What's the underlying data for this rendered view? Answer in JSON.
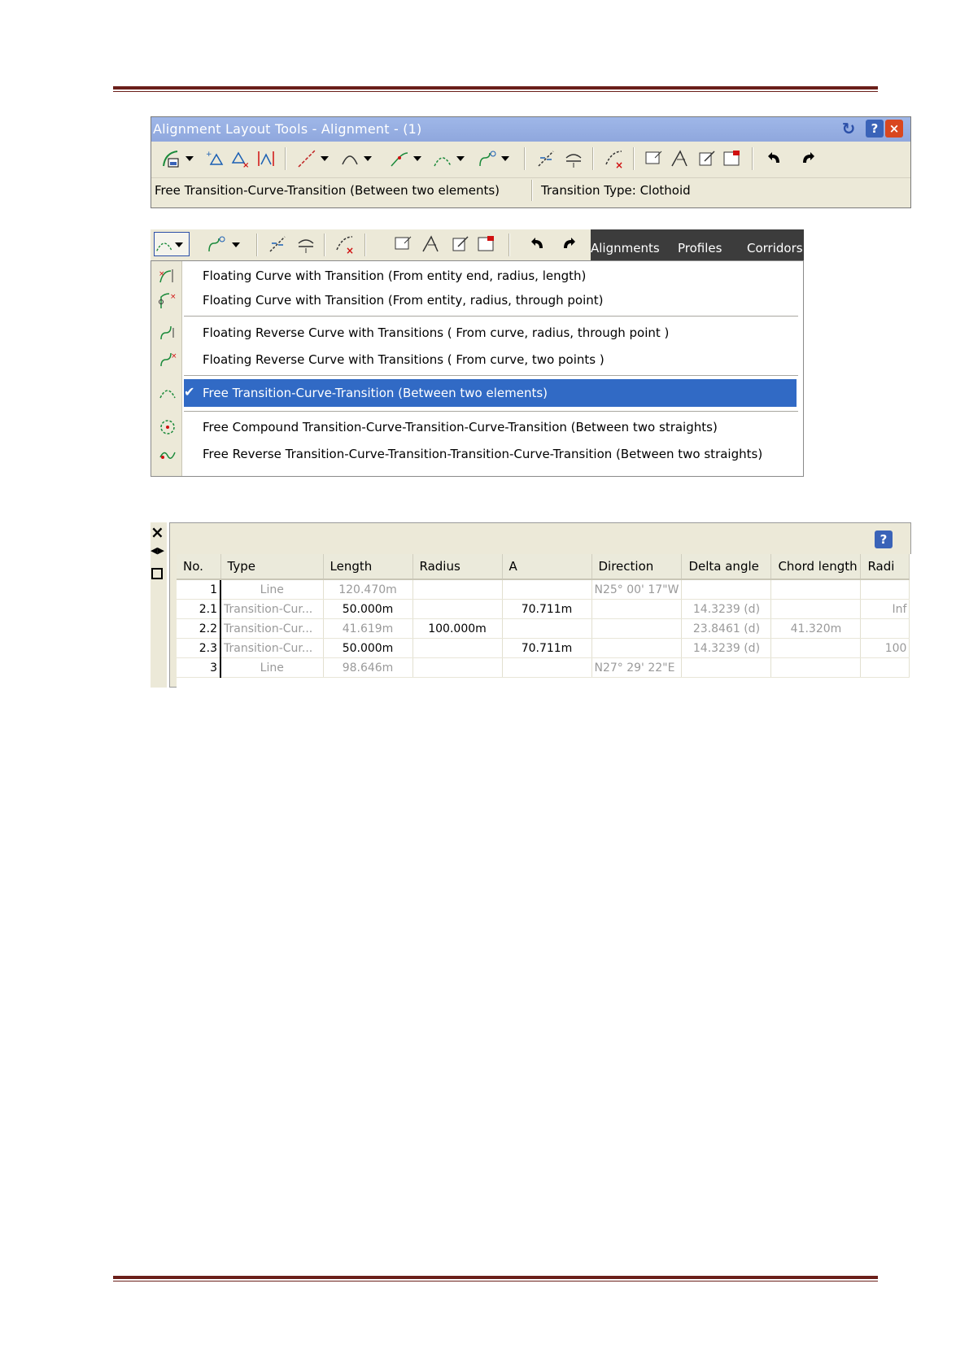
{
  "toolbar_window": {
    "title": "Alignment Layout Tools - Alignment - (1)",
    "status_left": "Free Transition-Curve-Transition (Between two elements)",
    "status_right": "Transition Type: Clothoid",
    "help_label": "?",
    "close_label": "×"
  },
  "menu_toolbar": {
    "tabs": [
      "Alignments",
      "Profiles",
      "Corridors"
    ]
  },
  "menu": {
    "items": [
      {
        "label": "Floating Curve with Transition (From entity end, radius, length)"
      },
      {
        "label": "Floating Curve with Transition (From entity, radius, through point)"
      },
      {
        "label": "Floating Reverse Curve with Transitions ( From curve, radius, through point )"
      },
      {
        "label": "Floating Reverse Curve with Transitions ( From curve, two points )"
      },
      {
        "label": "Free Transition-Curve-Transition (Between two elements)",
        "selected": true
      },
      {
        "label": "Free Compound Transition-Curve-Transition-Curve-Transition (Between two straights)"
      },
      {
        "label": "Free Reverse Transition-Curve-Transition-Transition-Curve-Transition (Between two straights)"
      }
    ],
    "check_mark": "✔"
  },
  "grid": {
    "help_label": "?",
    "close_label": "×",
    "columns": [
      "No.",
      "Type",
      "Length",
      "Radius",
      "A",
      "Direction",
      "Delta angle",
      "Chord length",
      "Radi"
    ],
    "rows": [
      [
        "1",
        "Line",
        "120.470m",
        "",
        "",
        "N25° 00' 17\"W",
        "",
        "",
        ""
      ],
      [
        "2.1",
        "Transition-Cur...",
        "50.000m",
        "",
        "70.711m",
        "",
        "14.3239 (d)",
        "",
        "Inf"
      ],
      [
        "2.2",
        "Transition-Cur...",
        "41.619m",
        "100.000m",
        "",
        "",
        "23.8461 (d)",
        "41.320m",
        ""
      ],
      [
        "2.3",
        "Transition-Cur...",
        "50.000m",
        "",
        "70.711m",
        "",
        "14.3239 (d)",
        "",
        "100"
      ],
      [
        "3",
        "Line",
        "98.646m",
        "",
        "",
        "N27° 29' 22\"E",
        "",
        "",
        ""
      ]
    ]
  },
  "colors": {
    "rule": "#6b1f1a",
    "title_bar": "#9fb7e8",
    "selection": "#316ac5",
    "toolbar_bg": "#ece9d8"
  }
}
